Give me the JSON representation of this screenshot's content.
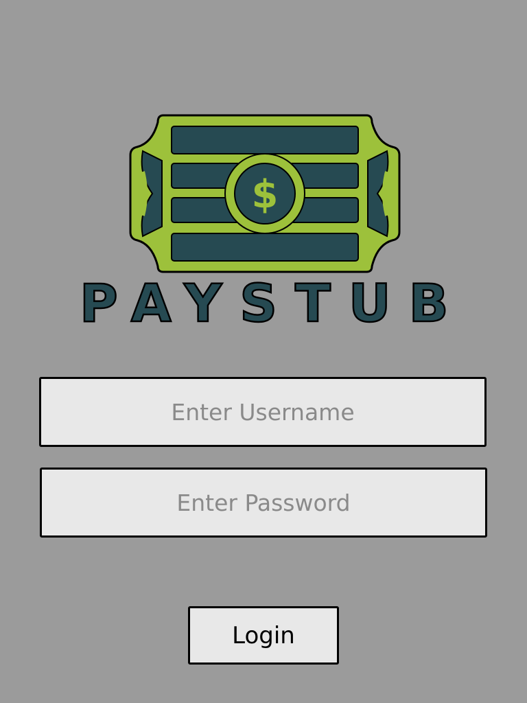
{
  "app": {
    "logo_text": "PAYSTUB+",
    "logo_icon": "cash-bill-dollar-icon"
  },
  "form": {
    "username": {
      "value": "",
      "placeholder": "Enter Username"
    },
    "password": {
      "value": "",
      "placeholder": "Enter Password"
    },
    "login_label": "Login"
  },
  "colors": {
    "background": "#9b9b9b",
    "bill_green": "#9dc13b",
    "bill_dark": "#264a52",
    "field_bg": "#e8e8e8"
  }
}
